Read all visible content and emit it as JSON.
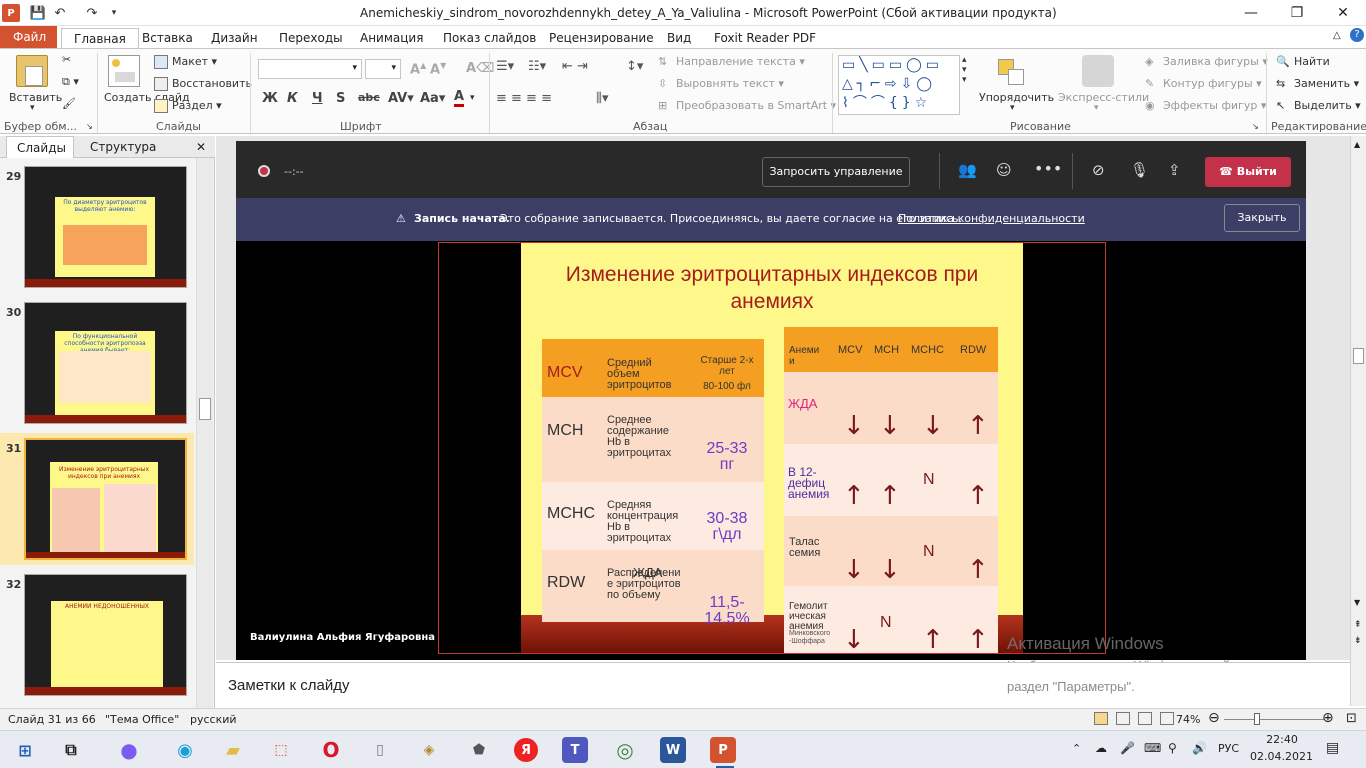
{
  "window": {
    "title": "Anemicheskiy_sindrom_novorozhdennykh_detey_A_Ya_Valiulina  -  Microsoft PowerPoint (Сбой активации продукта)",
    "minimize": "—",
    "maximize": "❐",
    "close": "✕"
  },
  "ribbon_tabs": [
    "Файл",
    "Главная",
    "Вставка",
    "Дизайн",
    "Переходы",
    "Анимация",
    "Показ слайдов",
    "Рецензирование",
    "Вид",
    "Foxit Reader PDF"
  ],
  "ribbon": {
    "clipboard": {
      "paste": "Вставить",
      "label": "Буфер обм..."
    },
    "slides": {
      "create": "Создать слайд",
      "layout": "Макет",
      "restore": "Восстановить",
      "section": "Раздел",
      "label": "Слайды"
    },
    "font": {
      "label": "Шрифт",
      "bold": "Ж",
      "italic": "К",
      "underline": "Ч",
      "strike": "S",
      "abc": "abc"
    },
    "paragraph": {
      "label": "Абзац",
      "text_dir": "Направление текста",
      "align_text": "Выровнять текст",
      "smartart": "Преобразовать в SmartArt"
    },
    "drawing": {
      "label": "Рисование",
      "arrange": "Упорядочить",
      "quick_styles": "Экспресс-стили",
      "fill": "Заливка фигуры",
      "outline": "Контур фигуры",
      "effects": "Эффекты фигур"
    },
    "editing": {
      "label": "Редактирование",
      "find": "Найти",
      "replace": "Заменить",
      "select": "Выделить"
    }
  },
  "left_pane": {
    "tabs": [
      "Слайды",
      "Структура"
    ],
    "thumbs": [
      {
        "num": "29",
        "title": "По диаметру эритроцитов выделяют анемию:"
      },
      {
        "num": "30",
        "title": "По функциональной способности эритропоэза анемия бывает:"
      },
      {
        "num": "31",
        "title": "Изменение эритроцитарных индексов при анемиях"
      },
      {
        "num": "32",
        "title": "АНЕМИИ НЕДОНОШЕННЫХ"
      }
    ]
  },
  "meeting": {
    "timer": "--:--",
    "request_control": "Запросить управление",
    "leave": "Выйти",
    "banner_bold": "Запись начата.",
    "banner_text": "Это собрание записывается. Присоединяясь, вы даете согласие на его запись.",
    "banner_link": "Политика конфиденциальности",
    "close_btn": "Закрыть",
    "presenter": "Валиулина Альфия Ягуфаровна"
  },
  "slide": {
    "title": "Изменение эритроцитарных индексов при анемиях",
    "left_table": [
      {
        "code": "MCV",
        "desc": "Средний объем эритроцитов",
        "value": "Старше 2-х лет",
        "value2": "80-100 фл"
      },
      {
        "code": "MCH",
        "desc": "Среднее содержание Hb в эритроцитах",
        "value": "25-33 пг"
      },
      {
        "code": "MCHC",
        "desc": "Средняя концентрация Hb в эритроцитах",
        "value": "30-38 г\\дл"
      },
      {
        "code": "RDW",
        "desc": "Распределени е эритроцитов по объему",
        "overlay": "ЖДА",
        "value": "11,5-14,5%"
      }
    ],
    "right_headers": [
      "Анеми и",
      "MCV",
      "MCH",
      "MCHC",
      "RDW"
    ],
    "right_rows": [
      {
        "name": "ЖДА",
        "marks": [
          "↓",
          "↓",
          "↓",
          "↑"
        ]
      },
      {
        "name": "В 12-дефиц анемия",
        "marks": [
          "↑",
          "↑",
          "N",
          "↑"
        ]
      },
      {
        "name": "Талас семия",
        "marks": [
          "↓",
          "↓",
          "N",
          "↑"
        ]
      },
      {
        "name": "Гемолит ическая анемия",
        "sub": "Минковского -Шоффара",
        "marks": [
          "↓",
          "N",
          "↑",
          "↑"
        ]
      }
    ]
  },
  "activation": {
    "line1": "Активация Windows",
    "line2": "Чтобы активировать Windows, перейдите в",
    "line3": "раздел \"Параметры\"."
  },
  "notes_placeholder": "Заметки к слайду",
  "status": {
    "slide": "Слайд 31 из 66",
    "theme": "\"Тема Office\"",
    "lang": "русский",
    "zoom": "74%"
  },
  "taskbar": {
    "lang": "РУС",
    "time": "22:40",
    "date": "02.04.2021"
  }
}
